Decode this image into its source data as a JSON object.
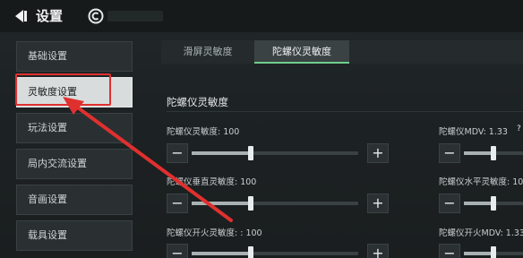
{
  "header": {
    "title": "设置",
    "back_icon": "back-arrow-icon",
    "extra_icon": "circle-c-icon"
  },
  "sidebar": {
    "items": [
      {
        "label": "基础设置",
        "active": false
      },
      {
        "label": "灵敏度设置",
        "active": true
      },
      {
        "label": "玩法设置",
        "active": false
      },
      {
        "label": "局内交流设置",
        "active": false
      },
      {
        "label": "音画设置",
        "active": false
      },
      {
        "label": "载具设置",
        "active": false
      }
    ]
  },
  "tabs": [
    {
      "label": "滑屏灵敏度",
      "active": false
    },
    {
      "label": "陀螺仪灵敏度",
      "active": true
    }
  ],
  "section": {
    "title": "陀螺仪灵敏度"
  },
  "sliders_left": [
    {
      "label": "陀螺仪灵敏度: 100",
      "level": 0.41
    },
    {
      "label": "陀螺仪垂直灵敏度: 100",
      "level": 0.41
    },
    {
      "label": "陀螺仪开火灵敏度: : 100",
      "level": 0.41
    }
  ],
  "sliders_right": [
    {
      "label": "陀螺仪MDV: 1.33",
      "help": "?"
    },
    {
      "label": "陀螺仪水平灵敏度: 100"
    },
    {
      "label": "陀螺仪开火MDV: 1.33"
    }
  ],
  "buttons": {
    "minus": "−",
    "plus": "+"
  },
  "colors": {
    "accent": "#6fcf8c",
    "annotation": "#e0302e"
  }
}
